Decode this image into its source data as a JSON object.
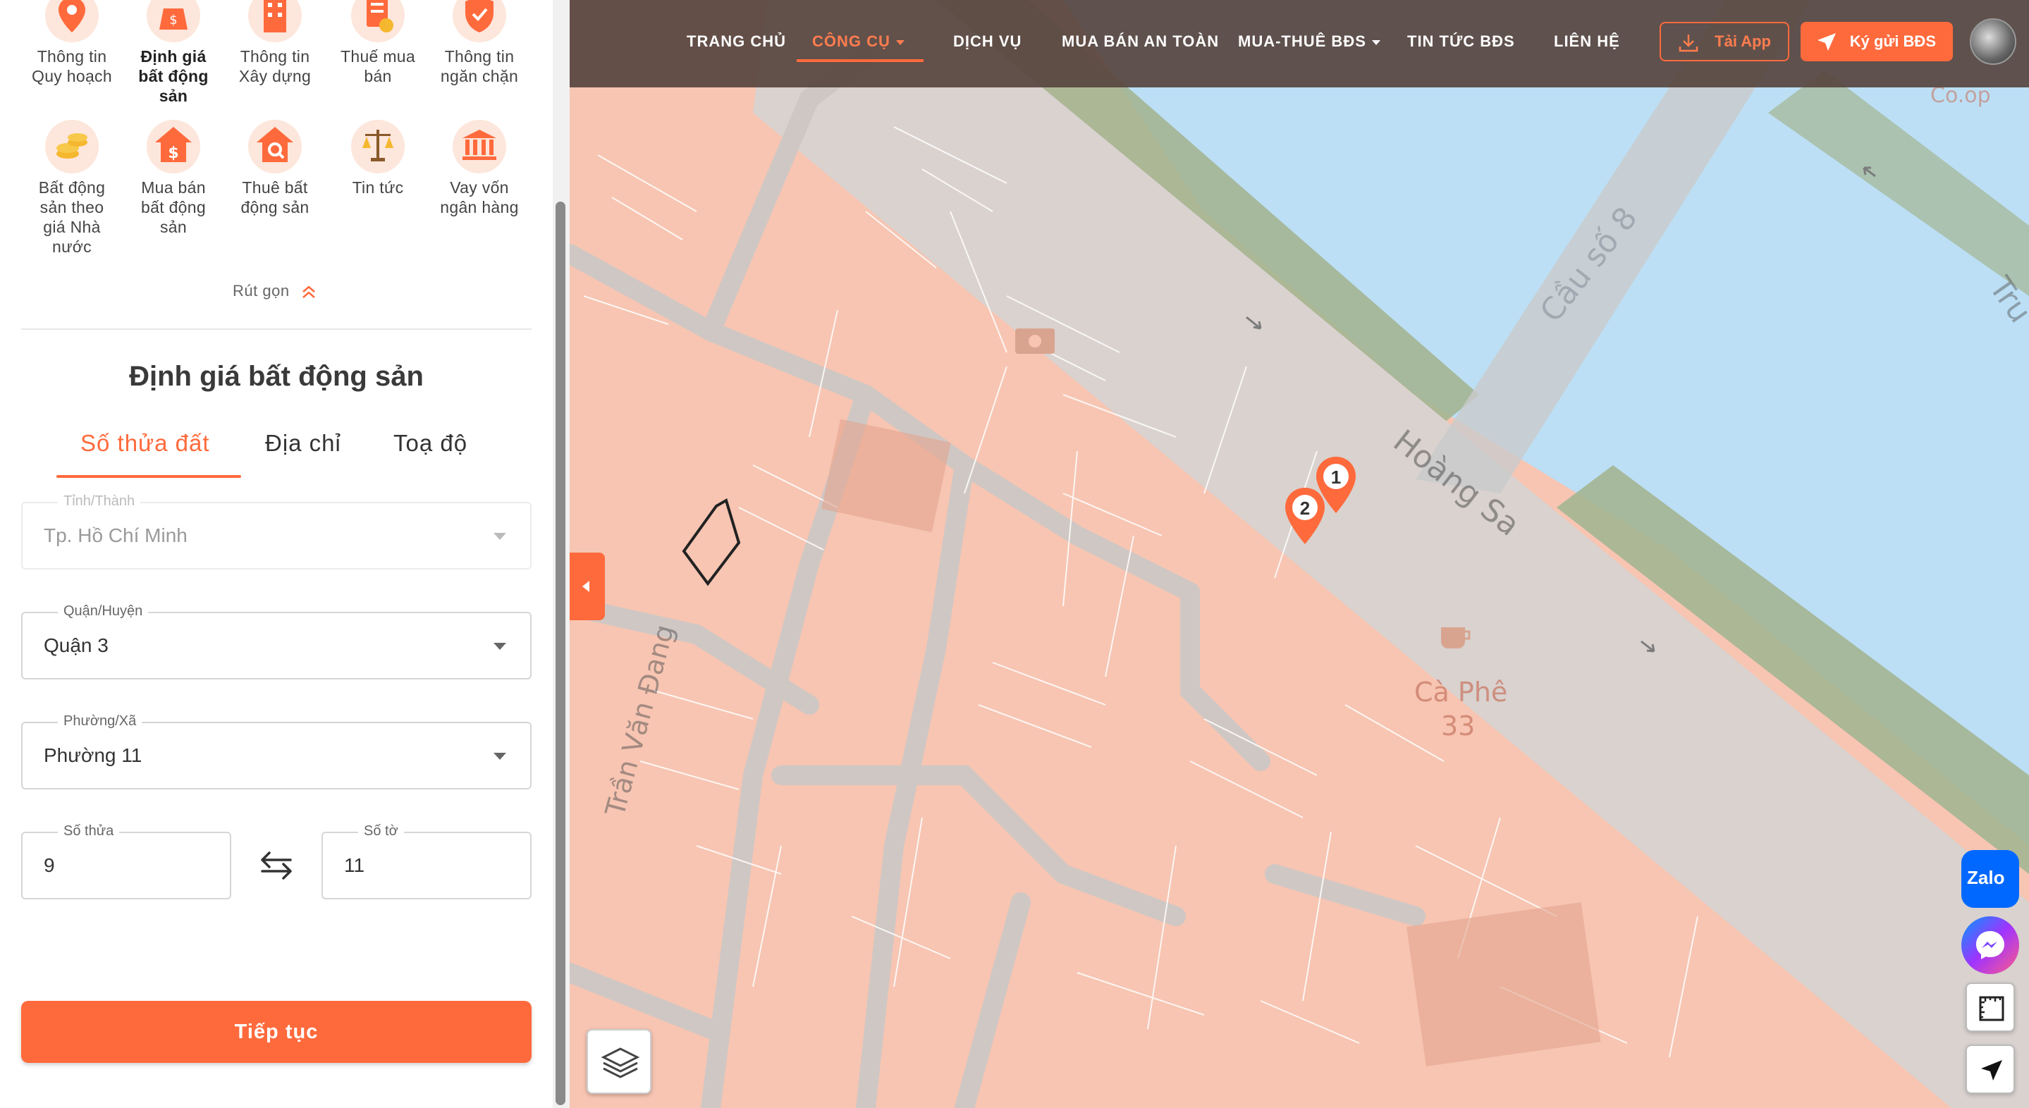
{
  "tools": [
    {
      "label": "Thông tin\nQuy hoạch",
      "icon": "map-pin-icon",
      "active": false
    },
    {
      "label": "Định giá\nbất động\nsản",
      "icon": "valuation-icon",
      "active": true
    },
    {
      "label": "Thông tin\nXây dựng",
      "icon": "building-icon",
      "active": false
    },
    {
      "label": "Thuế mua\nbán",
      "icon": "tax-document-icon",
      "active": false
    },
    {
      "label": "Thông tin\nngăn chặn",
      "icon": "shield-icon",
      "active": false
    },
    {
      "label": "Bất động\nsản theo\ngiá Nhà\nnước",
      "icon": "coins-icon",
      "active": false
    },
    {
      "label": "Mua bán\nbất động\nsản",
      "icon": "house-dollar-icon",
      "active": false
    },
    {
      "label": "Thuê bất\nđộng sản",
      "icon": "house-search-icon",
      "active": false
    },
    {
      "label": "Tin tức",
      "icon": "scales-icon",
      "active": false
    },
    {
      "label": "Vay vốn\nngân hàng",
      "icon": "bank-icon",
      "active": false
    }
  ],
  "collapse_label": "Rút gọn",
  "form": {
    "title": "Định giá bất động sản",
    "tabs": [
      "Số thửa đất",
      "Địa chỉ",
      "Toạ độ"
    ],
    "province": {
      "label": "Tỉnh/Thành",
      "value": "Tp. Hồ Chí Minh"
    },
    "district": {
      "label": "Quận/Huyện",
      "value": "Quận 3"
    },
    "ward": {
      "label": "Phường/Xã",
      "value": "Phường 11"
    },
    "parcel": {
      "label": "Số thửa",
      "value": "9"
    },
    "sheet": {
      "label": "Số tờ",
      "value": "11"
    },
    "submit": "Tiếp tục"
  },
  "nav": {
    "items": [
      {
        "label": "TRANG CHỦ",
        "dropdown": false,
        "active": false
      },
      {
        "label": "CÔNG CỤ",
        "dropdown": true,
        "active": true
      },
      {
        "label": "DỊCH VỤ",
        "dropdown": false,
        "active": false
      },
      {
        "label": "MUA BÁN AN TOÀN",
        "dropdown": false,
        "active": false
      },
      {
        "label": "MUA-THUÊ BĐS",
        "dropdown": true,
        "active": false
      },
      {
        "label": "TIN TỨC BĐS",
        "dropdown": false,
        "active": false
      },
      {
        "label": "LIÊN HỆ",
        "dropdown": false,
        "active": false
      }
    ],
    "app_button": "Tải App",
    "deposit_button": "Ký gửi BĐS"
  },
  "map": {
    "labels": {
      "road1": "Hoàng Sa",
      "bridge": "Cầu số 8",
      "street_left": "Trần Văn Đang",
      "cafe_line1": "Cà Phê",
      "cafe_line2": "33",
      "top_right": "Co.op",
      "edge_right": "Tru"
    },
    "markers": [
      "1",
      "2"
    ]
  },
  "widgets": {
    "zalo": "Zalo"
  },
  "colors": {
    "accent": "#ff6a3c",
    "navbar": "#584640",
    "parcel": "#f7c5b2",
    "water": "#bcdff5",
    "greenery": "#a3b592"
  }
}
